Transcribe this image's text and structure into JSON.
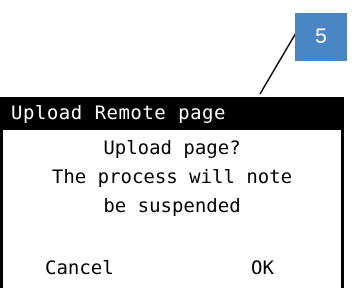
{
  "callout": {
    "label": "5",
    "color": "#4a86c5"
  },
  "screen": {
    "title": "Upload Remote page",
    "message_lines": [
      "Upload page?",
      "The process will note",
      "be suspended"
    ],
    "buttons": {
      "cancel": "Cancel",
      "ok": "OK"
    }
  }
}
